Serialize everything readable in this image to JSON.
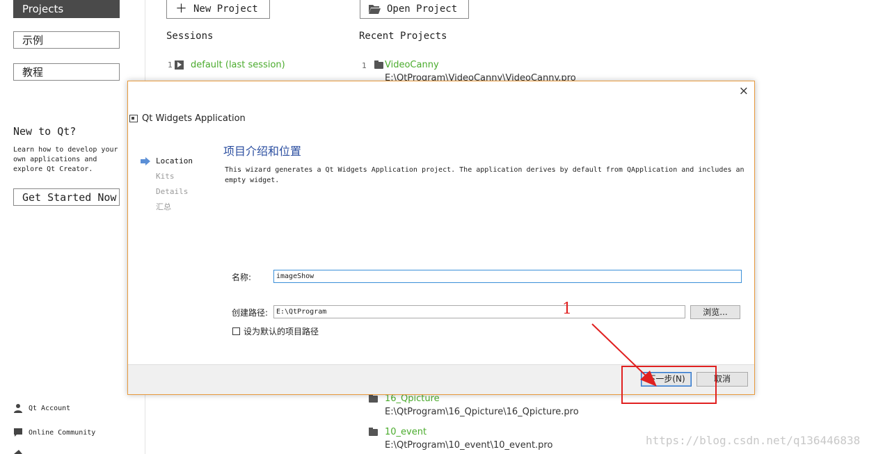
{
  "sidebar": {
    "projects": "Projects",
    "examples": "示例",
    "tutorials": "教程",
    "new_to_qt_title": "New to Qt?",
    "new_to_qt_text": "Learn how to develop your\nown applications and\nexplore Qt Creator.",
    "get_started": "Get Started Now",
    "qt_account": "Qt Account",
    "online_community": "Online Community"
  },
  "main": {
    "new_project": "New Project",
    "open_project": "Open Project",
    "sessions_title": "Sessions",
    "recent_title": "Recent Projects",
    "sessions": [
      {
        "num": "1",
        "name": "default (last session)"
      }
    ],
    "recent": [
      {
        "num": "1",
        "name": "VideoCanny",
        "path": "E:\\QtProgram\\VideoCanny\\VideoCanny.pro"
      },
      {
        "num": "",
        "name": "16_Qpicture",
        "path": "E:\\QtProgram\\16_Qpicture\\16_Qpicture.pro"
      },
      {
        "num": "",
        "name": "10_event",
        "path": "E:\\QtProgram\\10_event\\10_event.pro"
      }
    ]
  },
  "dialog": {
    "window_title": "Qt Widgets Application",
    "close": "×",
    "steps": [
      "Location",
      "Kits",
      "Details",
      "汇总"
    ],
    "page_title": "项目介绍和位置",
    "description": "This wizard generates a Qt Widgets Application project. The application derives by default from QApplication and includes an empty widget.",
    "name_label": "名称:",
    "name_value": "imageShow",
    "path_label": "创建路径:",
    "path_value": "E:\\QtProgram",
    "browse": "浏览...",
    "default_path_label": "设为默认的项目路径",
    "next": "下一步(N)",
    "cancel": "取消"
  },
  "annotation": {
    "number": "1",
    "color": "#e02020"
  },
  "watermark": "https://blog.csdn.net/q136446838"
}
